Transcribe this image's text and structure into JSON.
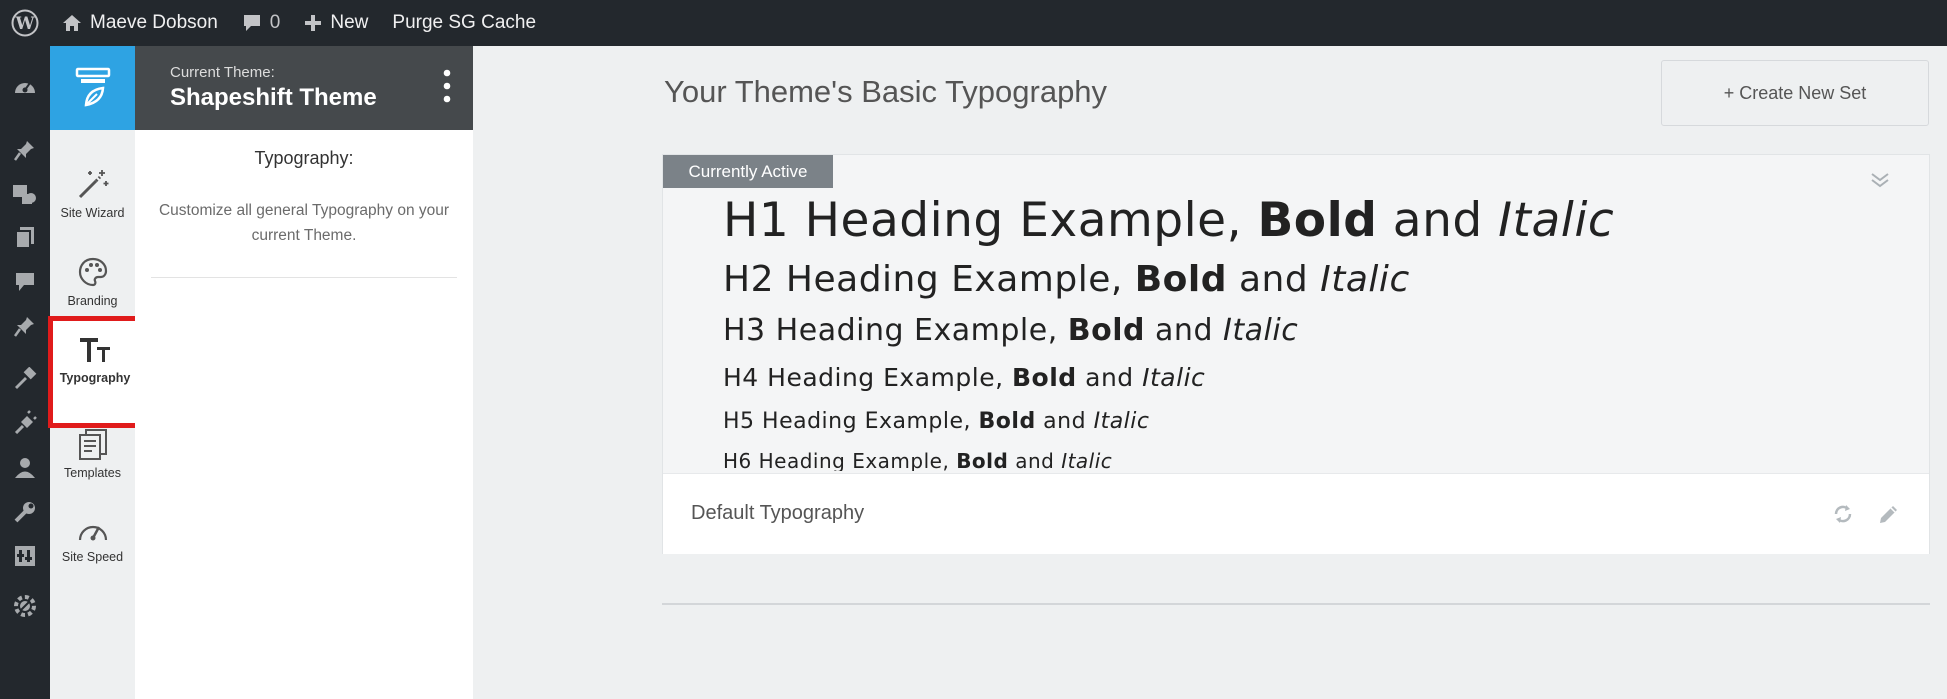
{
  "adminbar": {
    "wp_logo_icon": "wordpress-icon",
    "site_name": "Maeve Dobson",
    "comments_count": "0",
    "new_label": "New",
    "purge_label": "Purge SG Cache"
  },
  "adminmenu": {
    "icons": [
      "dashboard-icon",
      "pin-icon",
      "media-icon",
      "pages-icon",
      "comments-icon",
      "pin-icon",
      "appearance-icon",
      "plugins-icon",
      "users-icon",
      "tools-icon",
      "settings-icon",
      "gear-icon"
    ]
  },
  "rail": {
    "items": [
      {
        "label": "Site Wizard",
        "icon": "magic-wand-icon"
      },
      {
        "label": "Branding",
        "icon": "palette-icon"
      },
      {
        "label": "Typography",
        "icon": "typography-icon",
        "active": true
      },
      {
        "label": "Templates",
        "icon": "templates-icon"
      },
      {
        "label": "Site Speed",
        "icon": "speedometer-icon"
      }
    ]
  },
  "theme": {
    "current_label": "Current Theme:",
    "name": "Shapeshift Theme"
  },
  "panel": {
    "title": "Typography:",
    "description": "Customize all general Typography on your current Theme."
  },
  "main": {
    "title": "Your Theme's Basic Typography",
    "create_button": "+ Create New Set"
  },
  "card": {
    "badge": "Currently Active",
    "headings": [
      {
        "level": "H1",
        "text": "H1 Heading Example, ",
        "bold": "Bold",
        "and": " and ",
        "italic": "Italic"
      },
      {
        "level": "H2",
        "text": "H2 Heading Example, ",
        "bold": "Bold",
        "and": " and ",
        "italic": "Italic"
      },
      {
        "level": "H3",
        "text": "H3 Heading Example, ",
        "bold": "Bold",
        "and": " and ",
        "italic": "Italic"
      },
      {
        "level": "H4",
        "text": "H4 Heading Example, ",
        "bold": "Bold",
        "and": " and ",
        "italic": "Italic"
      },
      {
        "level": "H5",
        "text": "H5 Heading Example, ",
        "bold": "Bold",
        "and": " and ",
        "italic": "Italic"
      },
      {
        "level": "H6",
        "text": "H6 Heading Example, ",
        "bold": "Bold",
        "and": " and ",
        "italic": "Italic"
      }
    ],
    "set_name": "Default Typography"
  },
  "colors": {
    "adminbar": "#23282d",
    "brand": "#2ea3e3",
    "highlight": "#e01b1b",
    "badge": "#7b8288"
  }
}
